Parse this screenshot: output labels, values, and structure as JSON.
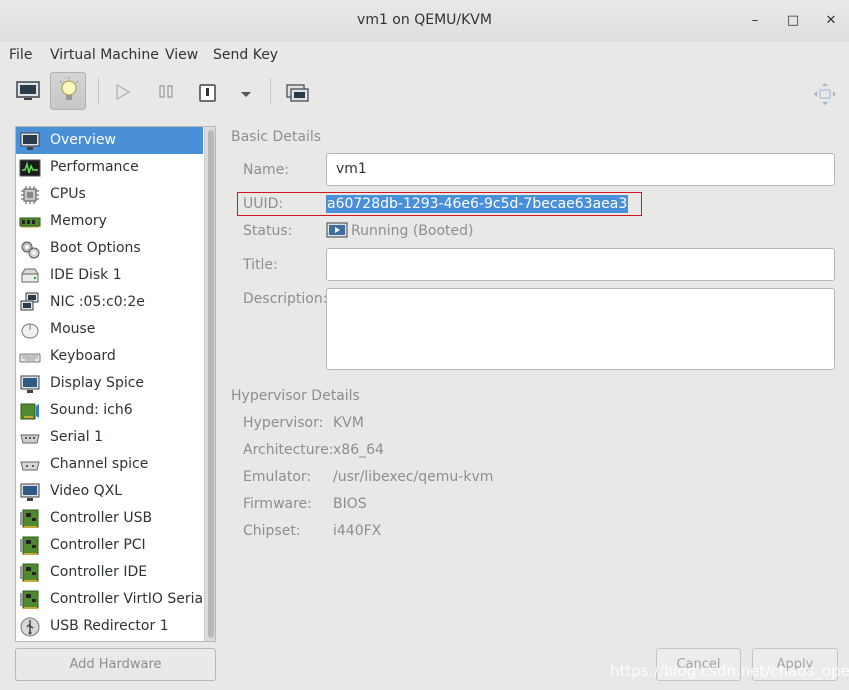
{
  "window": {
    "title": "vm1 on QEMU/KVM"
  },
  "window_controls": {
    "minimize": "–",
    "maximize": "□",
    "close": "✕"
  },
  "menu": [
    "File",
    "Virtual Machine",
    "View",
    "Send Key"
  ],
  "sidebar": {
    "items": [
      {
        "label": "Overview",
        "icon": "monitor-icon",
        "selected": true
      },
      {
        "label": "Performance",
        "icon": "performance-graph-icon"
      },
      {
        "label": "CPUs",
        "icon": "cpu-chip-icon"
      },
      {
        "label": "Memory",
        "icon": "memory-module-icon"
      },
      {
        "label": "Boot Options",
        "icon": "gears-icon"
      },
      {
        "label": "IDE Disk 1",
        "icon": "disk-drive-icon"
      },
      {
        "label": "NIC :05:c0:2e",
        "icon": "network-icon"
      },
      {
        "label": "Mouse",
        "icon": "mouse-icon"
      },
      {
        "label": "Keyboard",
        "icon": "keyboard-icon"
      },
      {
        "label": "Display Spice",
        "icon": "display-icon"
      },
      {
        "label": "Sound: ich6",
        "icon": "sound-card-icon"
      },
      {
        "label": "Serial 1",
        "icon": "serial-port-icon"
      },
      {
        "label": "Channel spice",
        "icon": "channel-icon"
      },
      {
        "label": "Video QXL",
        "icon": "video-card-icon"
      },
      {
        "label": "Controller USB",
        "icon": "controller-card-icon"
      },
      {
        "label": "Controller PCI",
        "icon": "controller-card-icon"
      },
      {
        "label": "Controller IDE",
        "icon": "controller-card-icon"
      },
      {
        "label": "Controller VirtIO Serial",
        "icon": "controller-card-icon"
      },
      {
        "label": "USB Redirector 1",
        "icon": "usb-icon"
      }
    ],
    "add_hardware_label": "Add Hardware"
  },
  "basic_details": {
    "title": "Basic Details",
    "name_label": "Name:",
    "name_value": "vm1",
    "uuid_label": "UUID:",
    "uuid_value": "a60728db-1293-46e6-9c5d-7becae63aea3",
    "status_label": "Status:",
    "status_value": "Running (Booted)",
    "title_label": "Title:",
    "title_value": "",
    "description_label": "Description:",
    "description_value": ""
  },
  "hypervisor_details": {
    "title": "Hypervisor Details",
    "rows": [
      {
        "label": "Hypervisor:",
        "value": "KVM"
      },
      {
        "label": "Architecture:",
        "value": "x86_64"
      },
      {
        "label": "Emulator:",
        "value": "/usr/libexec/qemu-kvm"
      },
      {
        "label": "Firmware:",
        "value": "BIOS"
      },
      {
        "label": "Chipset:",
        "value": "i440FX"
      }
    ]
  },
  "buttons": {
    "cancel": "Cancel",
    "apply": "Apply"
  },
  "watermark": "https://blog.csdn.net/chaos_oper",
  "colors": {
    "selection": "#4a90d9",
    "highlight_box": "#d3151f"
  }
}
